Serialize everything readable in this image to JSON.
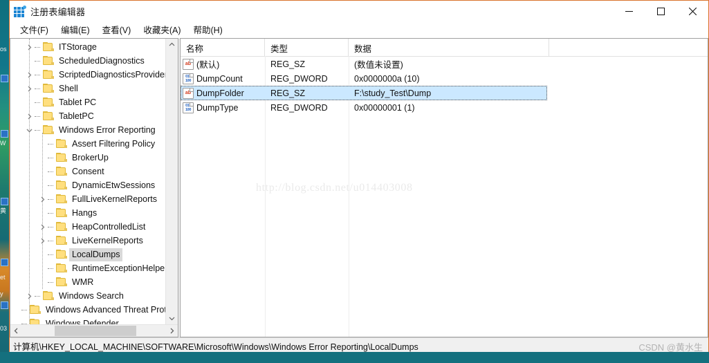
{
  "window": {
    "title": "注册表编辑器",
    "icon": "registry-grid-icon",
    "controls": {
      "minimize": "minimize",
      "maximize": "maximize",
      "close": "close"
    }
  },
  "menubar": {
    "items": [
      {
        "label": "文件(F)",
        "name": "menu-file"
      },
      {
        "label": "编辑(E)",
        "name": "menu-edit"
      },
      {
        "label": "查看(V)",
        "name": "menu-view"
      },
      {
        "label": "收藏夹(A)",
        "name": "menu-favorites"
      },
      {
        "label": "帮助(H)",
        "name": "menu-help"
      }
    ]
  },
  "tree": {
    "items": [
      {
        "label": "ITStorage",
        "depth": 1,
        "expander": "collapsed",
        "selected": false
      },
      {
        "label": "ScheduledDiagnostics",
        "depth": 1,
        "expander": "none",
        "selected": false
      },
      {
        "label": "ScriptedDiagnosticsProvider",
        "depth": 1,
        "expander": "collapsed",
        "selected": false
      },
      {
        "label": "Shell",
        "depth": 1,
        "expander": "collapsed",
        "selected": false
      },
      {
        "label": "Tablet PC",
        "depth": 1,
        "expander": "none",
        "selected": false
      },
      {
        "label": "TabletPC",
        "depth": 1,
        "expander": "collapsed",
        "selected": false
      },
      {
        "label": "Windows Error Reporting",
        "depth": 1,
        "expander": "expanded",
        "selected": false
      },
      {
        "label": "Assert Filtering Policy",
        "depth": 2,
        "expander": "none",
        "selected": false
      },
      {
        "label": "BrokerUp",
        "depth": 2,
        "expander": "none",
        "selected": false
      },
      {
        "label": "Consent",
        "depth": 2,
        "expander": "none",
        "selected": false
      },
      {
        "label": "DynamicEtwSessions",
        "depth": 2,
        "expander": "none",
        "selected": false
      },
      {
        "label": "FullLiveKernelReports",
        "depth": 2,
        "expander": "collapsed",
        "selected": false
      },
      {
        "label": "Hangs",
        "depth": 2,
        "expander": "none",
        "selected": false
      },
      {
        "label": "HeapControlledList",
        "depth": 2,
        "expander": "collapsed",
        "selected": false
      },
      {
        "label": "LiveKernelReports",
        "depth": 2,
        "expander": "collapsed",
        "selected": false
      },
      {
        "label": "LocalDumps",
        "depth": 2,
        "expander": "none",
        "selected": true
      },
      {
        "label": "RuntimeExceptionHelperMo",
        "depth": 2,
        "expander": "none",
        "selected": false
      },
      {
        "label": "WMR",
        "depth": 2,
        "expander": "none",
        "selected": false
      },
      {
        "label": "Windows Search",
        "depth": 1,
        "expander": "collapsed",
        "selected": false
      },
      {
        "label": "Windows Advanced Threat Protec",
        "depth": 0,
        "expander": "none",
        "selected": false
      },
      {
        "label": "Windows Defender",
        "depth": 0,
        "expander": "none",
        "selected": false
      }
    ],
    "scrollbar": {
      "up": "scroll-up",
      "down": "scroll-down",
      "left": "scroll-left",
      "right": "scroll-right"
    }
  },
  "list": {
    "columns": [
      {
        "label": "名称",
        "name": "column-name"
      },
      {
        "label": "类型",
        "name": "column-type"
      },
      {
        "label": "数据",
        "name": "column-data"
      }
    ],
    "rows": [
      {
        "name": "(默认)",
        "type": "REG_SZ",
        "data": "(数值未设置)",
        "icon": "reg-sz-icon",
        "selected": false
      },
      {
        "name": "DumpCount",
        "type": "REG_DWORD",
        "data": "0x0000000a (10)",
        "icon": "reg-dword-icon",
        "selected": false
      },
      {
        "name": "DumpFolder",
        "type": "REG_SZ",
        "data": "F:\\study_Test\\Dump",
        "icon": "reg-sz-icon",
        "selected": true
      },
      {
        "name": "DumpType",
        "type": "REG_DWORD",
        "data": "0x00000001 (1)",
        "icon": "reg-dword-icon",
        "selected": false
      }
    ]
  },
  "watermark": "http://blog.csdn.net/u014403008",
  "statusbar": {
    "path": "计算机\\HKEY_LOCAL_MACHINE\\SOFTWARE\\Microsoft\\Windows\\Windows Error Reporting\\LocalDumps",
    "credit": "CSDN @黄水生"
  },
  "desktop": {
    "left_labels": [
      "os",
      "W",
      "黄",
      "et",
      "y",
      "03"
    ]
  },
  "colors": {
    "window_border": "#d9722b",
    "selection_list": "#cbe8ff",
    "selection_tree": "#d9d9d9",
    "folder": "#ffdf7f",
    "accent_icon": "#1c86d4"
  }
}
